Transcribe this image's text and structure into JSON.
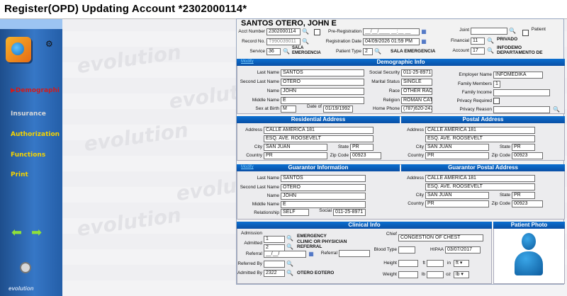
{
  "title": "Register(OPD) Updating  Account *2302000114*",
  "sidebar": {
    "items": [
      "Demographi",
      "Insurance",
      "Authorization",
      "Functions",
      "Print"
    ],
    "brand": "evolution"
  },
  "patient_name": "SANTOS OTERO, JOHN E",
  "account": {
    "acct_label": "Acct Number",
    "acct_value": "2302000114",
    "record_label": "Record No.",
    "record_value": "T990039011",
    "service_label": "Service",
    "service_value": "36",
    "service_desc": "SALA EMERGENCIA",
    "prereg_label": "Pre-Registration",
    "prereg_value": "__/__/____ __:__ __",
    "regdate_label": "Registration Date",
    "regdate_value": "04/09/2026 01:59 PM",
    "ptype_label": "Patient Type",
    "ptype_value": "2",
    "ptype_desc": "SALA EMERGENCIA",
    "joint_label": "Joint",
    "patient_label": "Patient",
    "financial_label": "Financial",
    "financial_value": "11",
    "financial_desc": "PRIVADO",
    "account_label": "Account",
    "account_value": "17",
    "account_desc": "INFODEMO DEPARTAMENTO DE"
  },
  "demo": {
    "header": "Demographic Info",
    "mode": "Modify",
    "last_label": "Last Name",
    "last": "SANTOS",
    "second_label": "Second Last Name",
    "second": "OTERO",
    "name_label": "Name",
    "name": "JOHN",
    "middle_label": "Middle Name",
    "middle": "E",
    "sex_label": "Sex at Birth",
    "sex": "M",
    "dob_label": "Date of",
    "dob": "01/19/1992",
    "ssn_label": "Social Security",
    "ssn": "011-25-8971",
    "marital_label": "Marital Status",
    "marital": "SINGLE",
    "race_label": "Race",
    "race": "OTHER RACE",
    "religion_label": "Religion",
    "religion": "ROMAN CATHOLIC CH",
    "phone_label": "Home Phone",
    "phone": "(787)620-2474",
    "employer_label": "Employer Name",
    "employer": "INFOMEDIKA",
    "family_label": "Family Members",
    "family": "1",
    "income_label": "Family Income",
    "income": "",
    "privacy_req_label": "Privacy Required",
    "privacy_reason_label": "Privacy Reason",
    "privacy_reason": ""
  },
  "res": {
    "header": "Residential Address",
    "addr_label": "Address",
    "addr1": "CALLE AMERICA 181",
    "addr2": "ESQ. AVE. ROOSEVELT",
    "city_label": "City",
    "city": "SAN JUAN",
    "state_label": "State",
    "state": "PR",
    "country_label": "Country",
    "country": "PR",
    "zip_label": "Zip Code",
    "zip": "00923"
  },
  "postal": {
    "header": "Postal Address",
    "addr_label": "Address",
    "addr1": "CALLE AMERICA 181",
    "addr2": "ESQ. AVE. ROOSEVELT",
    "city_label": "City",
    "city": "SAN JUAN",
    "state_label": "State",
    "state": "PR",
    "country_label": "Country",
    "country": "PR",
    "zip_label": "Zip Code",
    "zip": "00923"
  },
  "guar": {
    "header": "Guarantor Information",
    "mode": "Modify",
    "last_label": "Last Name",
    "last": "SANTOS",
    "second_label": "Second Last Name",
    "second": "OTERO",
    "name_label": "Name",
    "name": "JOHN",
    "middle_label": "Middle Name",
    "middle": "E",
    "rel_label": "Relationship",
    "rel": "SELF",
    "social_label": "Social",
    "social": "011-25-8971"
  },
  "gpostal": {
    "header": "Guarantor Postal Address",
    "addr_label": "Address",
    "addr1": "CALLE AMERICA 181",
    "addr2": "ESQ. AVE. ROOSEVELT",
    "city_label": "City",
    "city": "SAN JUAN",
    "state_label": "State",
    "state": "PR",
    "country_label": "Country",
    "country": "PR",
    "zip_label": "Zip Code",
    "zip": "00923"
  },
  "clin": {
    "header": "Clinical Info",
    "adm_label": "Admission",
    "adm": "1",
    "adm_desc": "EMERGENCY",
    "admitted_label": "Admitted",
    "admitted": "2",
    "admitted_desc": "CLINIC OR PHYSICIAN REFERRAL",
    "referral_label": "Referral",
    "referral_date": "__/__/",
    "referral2_label": "Referral",
    "refby_label": "Referred By",
    "admby_label": "Admitted By",
    "admby": "2322",
    "admby_desc": "OTERO EOTERO",
    "chief_label": "Chief",
    "chief": "CONGESTION OF CHEST",
    "blood_label": "Blood Type",
    "hipaa_label": "HIPAA",
    "hipaa": "03/07/2017",
    "height_label": "Height",
    "ft": "ft",
    "in": "in",
    "height_unit": "ft",
    "weight_label": "Weight",
    "lb": "lb",
    "oz": "oz",
    "weight_unit": "lb"
  },
  "photo": {
    "header": "Patient Photo"
  }
}
